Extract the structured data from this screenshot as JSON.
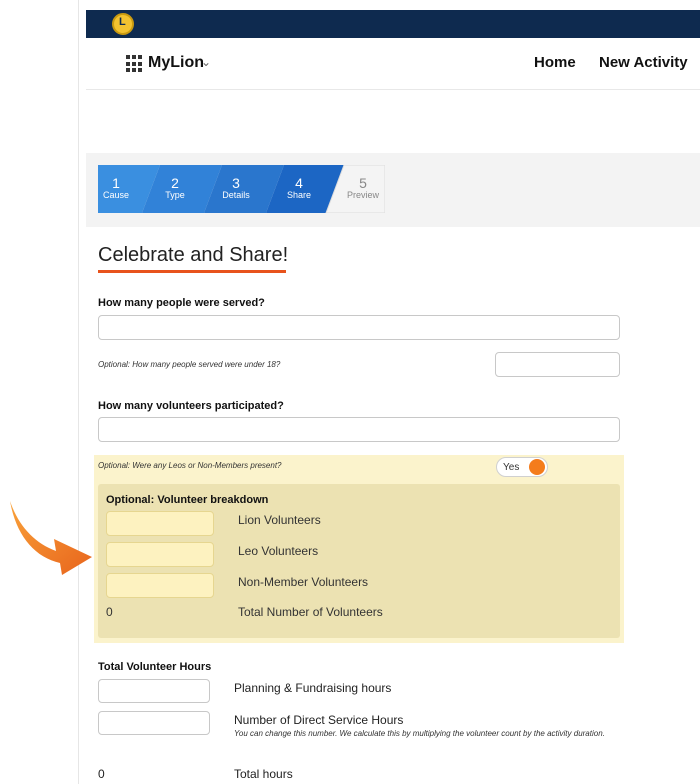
{
  "navbar": {
    "brand": "MyLion",
    "links": [
      "Home",
      "New Activity"
    ]
  },
  "stepper": {
    "steps": [
      {
        "number": "1",
        "label": "Cause",
        "color": "#3a8fe0"
      },
      {
        "number": "2",
        "label": "Type",
        "color": "#3182d8"
      },
      {
        "number": "3",
        "label": "Details",
        "color": "#2a76cd"
      },
      {
        "number": "4",
        "label": "Share",
        "color": "#1c66c4"
      },
      {
        "number": "5",
        "label": "Preview",
        "color": "#f4f4f4"
      }
    ],
    "active_step": 4
  },
  "page": {
    "title": "Celebrate and Share!"
  },
  "form": {
    "people_served_label": "How many people were served?",
    "people_served_value": "",
    "under_18_label": "Optional: How many people served were under 18?",
    "under_18_value": "",
    "volunteers_label": "How many volunteers participated?",
    "volunteers_value": "",
    "leos_label": "Optional: Were any Leos or Non-Members present?",
    "leos_toggle": "Yes"
  },
  "breakdown": {
    "heading": "Optional: Volunteer breakdown",
    "rows": [
      {
        "label": "Lion Volunteers",
        "value": ""
      },
      {
        "label": "Leo Volunteers",
        "value": ""
      },
      {
        "label": "Non-Member Volunteers",
        "value": ""
      }
    ],
    "total_value": "0",
    "total_label": "Total Number of Volunteers"
  },
  "hours": {
    "heading": "Total Volunteer Hours",
    "planning_label": "Planning & Fundraising hours",
    "planning_value": "",
    "direct_label": "Number of Direct Service Hours",
    "direct_value": "",
    "direct_note": "You can change this number. We calculate this by multiplying the volunteer count by the activity duration.",
    "total_value": "0",
    "total_label": "Total hours"
  },
  "colors": {
    "topbar": "#0e2a4f",
    "accent_orange": "#e8531c",
    "highlight_yellow": "#fbf3cc",
    "breakdown_bg": "#ece2b2"
  },
  "icons": {
    "logo": "lions-logo-icon",
    "apps": "apps-grid-icon",
    "chevron": "chevron-down-icon",
    "arrow": "orange-arrow-icon"
  }
}
